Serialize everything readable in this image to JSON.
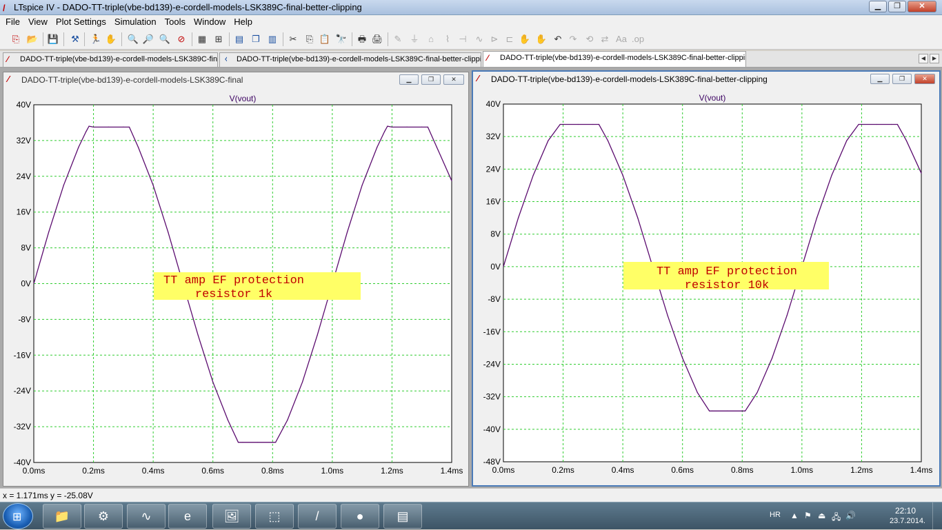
{
  "window": {
    "title": "LTspice IV - DADO-TT-triple(vbe-bd139)-e-cordell-models-LSK389C-final-better-clipping",
    "minimize": "▁",
    "maximize": "❐",
    "close": "✕"
  },
  "menu": [
    "File",
    "View",
    "Plot Settings",
    "Simulation",
    "Tools",
    "Window",
    "Help"
  ],
  "tabs": [
    {
      "label": "DADO-TT-triple(vbe-bd139)-e-cordell-models-LSK389C-final",
      "icon": "waveform-icon"
    },
    {
      "label": "DADO-TT-triple(vbe-bd139)-e-cordell-models-LSK389C-final-better-clipping",
      "icon": "schematic-icon"
    },
    {
      "label": "DADO-TT-triple(vbe-bd139)-e-cordell-models-LSK389C-final-better-clipping",
      "icon": "waveform-icon"
    }
  ],
  "panes": [
    {
      "title": "DADO-TT-triple(vbe-bd139)-e-cordell-models-LSK389C-final",
      "trace_label": "V(vout)",
      "annotation": [
        "TT amp EF protection",
        "resistor 1k"
      ],
      "chart_data": {
        "type": "line",
        "title": "V(vout)",
        "xlim": [
          0,
          1.4
        ],
        "ylim": [
          -40,
          40
        ],
        "x_ticks": [
          "0.0ms",
          "0.2ms",
          "0.4ms",
          "0.6ms",
          "0.8ms",
          "1.0ms",
          "1.2ms",
          "1.4ms"
        ],
        "y_ticks": [
          "40V",
          "32V",
          "24V",
          "16V",
          "8V",
          "0V",
          "-8V",
          "-16V",
          "-24V",
          "-32V",
          "-40V"
        ],
        "grid": true,
        "series": [
          {
            "name": "V(vout)",
            "color": "#5a0a6e",
            "x": [
              0,
              0.05,
              0.1,
              0.15,
              0.175,
              0.185,
              0.2,
              0.25,
              0.3,
              0.32,
              0.35,
              0.4,
              0.45,
              0.5,
              0.55,
              0.6,
              0.65,
              0.685,
              0.7,
              0.75,
              0.8,
              0.81,
              0.85,
              0.9,
              0.95,
              1.0,
              1.05,
              1.1,
              1.15,
              1.175,
              1.185,
              1.2,
              1.25,
              1.3,
              1.32,
              1.35,
              1.4
            ],
            "y": [
              0,
              11.5,
              22,
              30.5,
              34,
              35.2,
              35,
              35,
              35,
              35,
              30.5,
              22,
              11.5,
              0,
              -11.5,
              -22,
              -30.5,
              -35.5,
              -35.5,
              -35.5,
              -35.5,
              -35.5,
              -30.5,
              -22,
              -11.5,
              0,
              11.5,
              22,
              30.5,
              34,
              35.2,
              35,
              35,
              35,
              35,
              30.5,
              23
            ]
          }
        ]
      }
    },
    {
      "title": "DADO-TT-triple(vbe-bd139)-e-cordell-models-LSK389C-final-better-clipping",
      "trace_label": "V(vout)",
      "annotation": [
        "TT amp EF protection",
        "resistor 10k"
      ],
      "chart_data": {
        "type": "line",
        "title": "V(vout)",
        "xlim": [
          0,
          1.4
        ],
        "ylim": [
          -48,
          40
        ],
        "x_ticks": [
          "0.0ms",
          "0.2ms",
          "0.4ms",
          "0.6ms",
          "0.8ms",
          "1.0ms",
          "1.2ms",
          "1.4ms"
        ],
        "y_ticks": [
          "40V",
          "32V",
          "24V",
          "16V",
          "8V",
          "0V",
          "-8V",
          "-16V",
          "-24V",
          "-32V",
          "-40V",
          "-48V"
        ],
        "grid": true,
        "series": [
          {
            "name": "V(vout)",
            "color": "#5a0a6e",
            "x": [
              0,
              0.05,
              0.1,
              0.15,
              0.19,
              0.2,
              0.25,
              0.3,
              0.32,
              0.35,
              0.4,
              0.45,
              0.5,
              0.55,
              0.6,
              0.65,
              0.69,
              0.7,
              0.75,
              0.8,
              0.81,
              0.85,
              0.9,
              0.95,
              1.0,
              1.05,
              1.1,
              1.15,
              1.19,
              1.2,
              1.25,
              1.3,
              1.32,
              1.35,
              1.4
            ],
            "y": [
              0,
              12,
              22.5,
              31,
              35,
              35,
              35,
              35,
              35,
              31,
              22.5,
              12,
              0,
              -12,
              -22.5,
              -31,
              -35.5,
              -35.5,
              -35.5,
              -35.5,
              -35.5,
              -31,
              -22.5,
              -12,
              0,
              12,
              22.5,
              31,
              35,
              35,
              35,
              35,
              35,
              31,
              23
            ]
          }
        ]
      }
    }
  ],
  "status": "x = 1.171ms    y = -25.08V",
  "taskbar": {
    "language": "HR",
    "time": "22:10",
    "date": "23.7.2014."
  },
  "colors": {
    "grid": "#2ecc2e",
    "trace": "#5a0a6e",
    "annotation_bg": "#ffff66",
    "annotation_text": "#c00000",
    "label": "#3a0060"
  }
}
